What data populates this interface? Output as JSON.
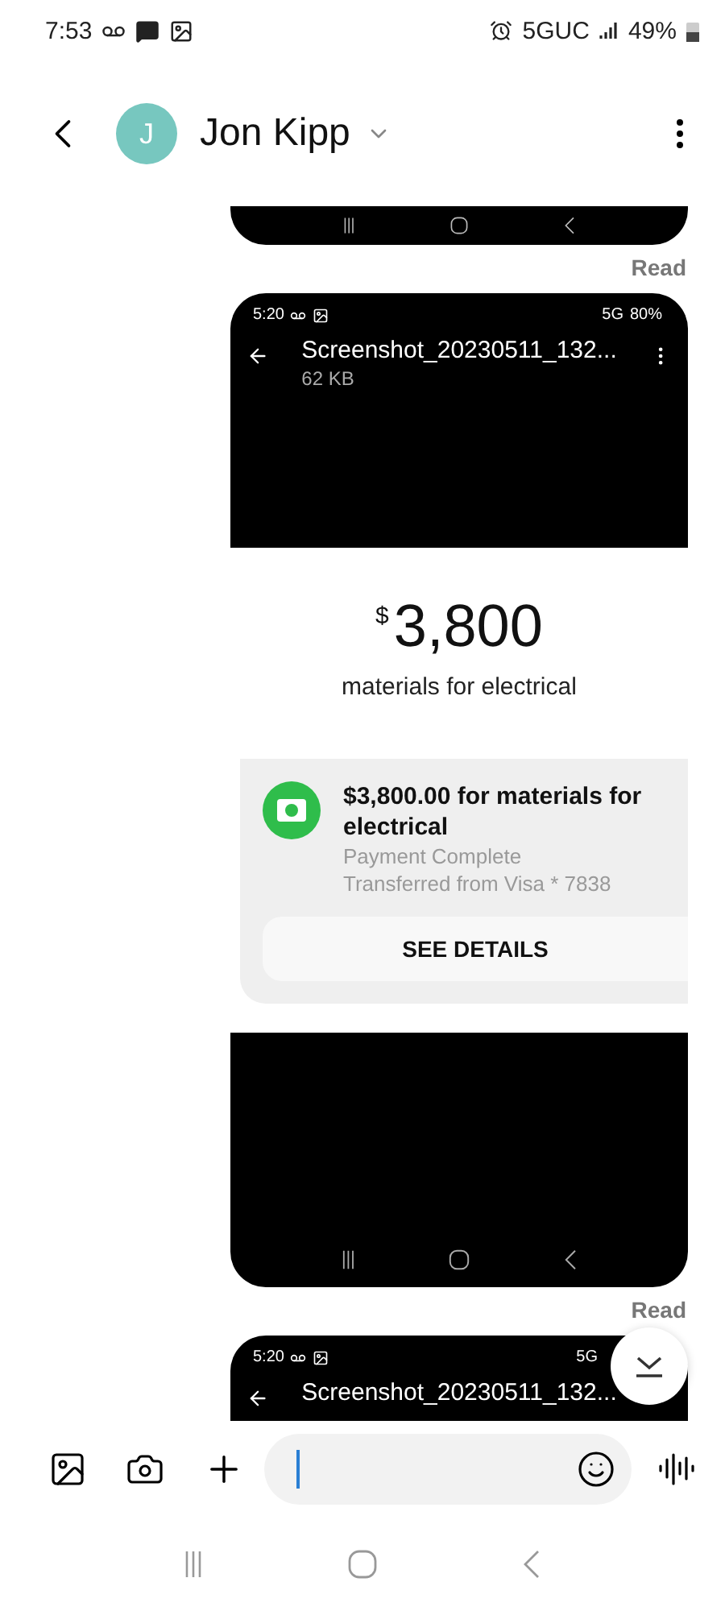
{
  "status_bar": {
    "time": "7:53",
    "network": "5GUC",
    "battery": "49%"
  },
  "header": {
    "avatar_initial": "J",
    "contact_name": "Jon Kipp"
  },
  "messages": [
    {
      "kind": "image_tail",
      "receipt": "Read"
    },
    {
      "kind": "image",
      "receipt": "Read",
      "shot": {
        "time": "5:20",
        "network": "5G",
        "battery": "80%",
        "filename": "Screenshot_20230511_132...",
        "size": "62 KB",
        "currency_symbol": "$",
        "amount": "3,800",
        "memo": "materials for electrical",
        "payment_title": "$3,800.00 for materials for electrical",
        "payment_status": "Payment Complete",
        "payment_source": "Transferred from Visa * 7838",
        "button": "SEE DETAILS"
      }
    },
    {
      "kind": "image_head",
      "shot": {
        "time": "5:20",
        "network": "5G",
        "filename": "Screenshot_20230511_132..."
      }
    }
  ],
  "composer": {
    "focused": true
  }
}
